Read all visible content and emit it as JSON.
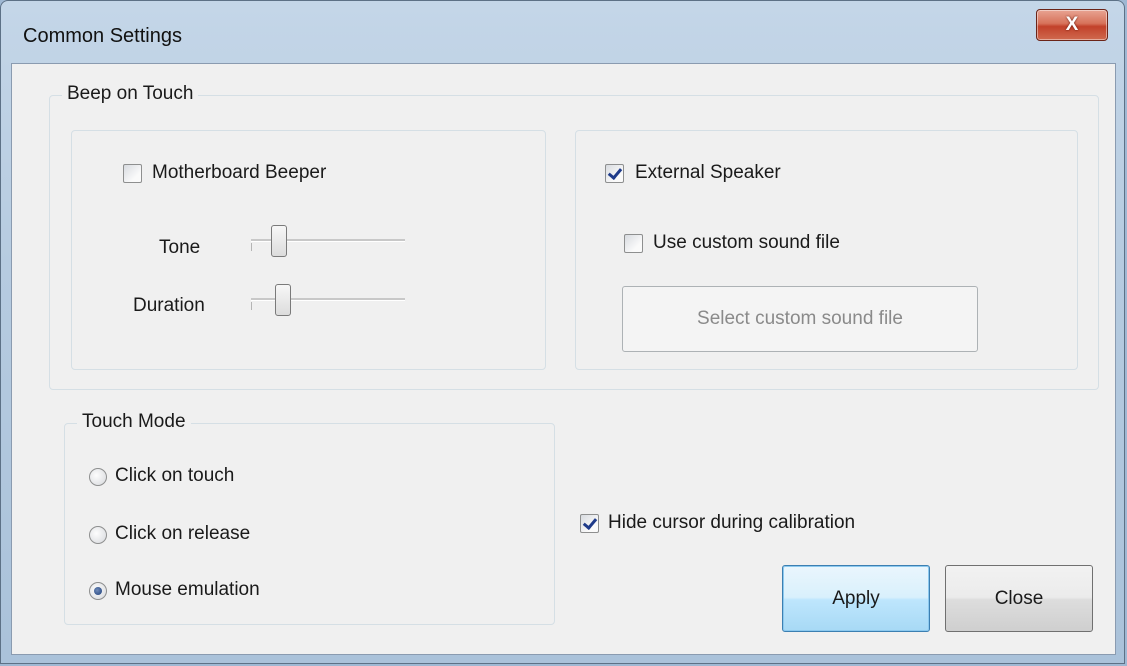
{
  "window": {
    "title": "Common Settings",
    "close_glyph": "X"
  },
  "beep_group": {
    "title": "Beep on Touch",
    "motherboard": {
      "label": "Motherboard Beeper",
      "checked": false
    },
    "tone": {
      "label": "Tone",
      "level": 0.2
    },
    "duration": {
      "label": "Duration",
      "level": 0.2
    },
    "external": {
      "label": "External Speaker",
      "checked": true
    },
    "custom_sound": {
      "label": "Use custom sound file",
      "checked": false
    },
    "select_button": "Select custom sound file"
  },
  "touch_mode": {
    "title": "Touch Mode",
    "options": [
      {
        "label": "Click on touch",
        "selected": false
      },
      {
        "label": "Click on release",
        "selected": false
      },
      {
        "label": "Mouse emulation",
        "selected": true
      }
    ]
  },
  "hide_cursor": {
    "label": "Hide cursor during calibration",
    "checked": true
  },
  "buttons": {
    "apply": "Apply",
    "close": "Close"
  },
  "colors": {
    "accent": "#3c7fb1",
    "close_red": "#c2412a",
    "frame": "#b6cbe0"
  }
}
